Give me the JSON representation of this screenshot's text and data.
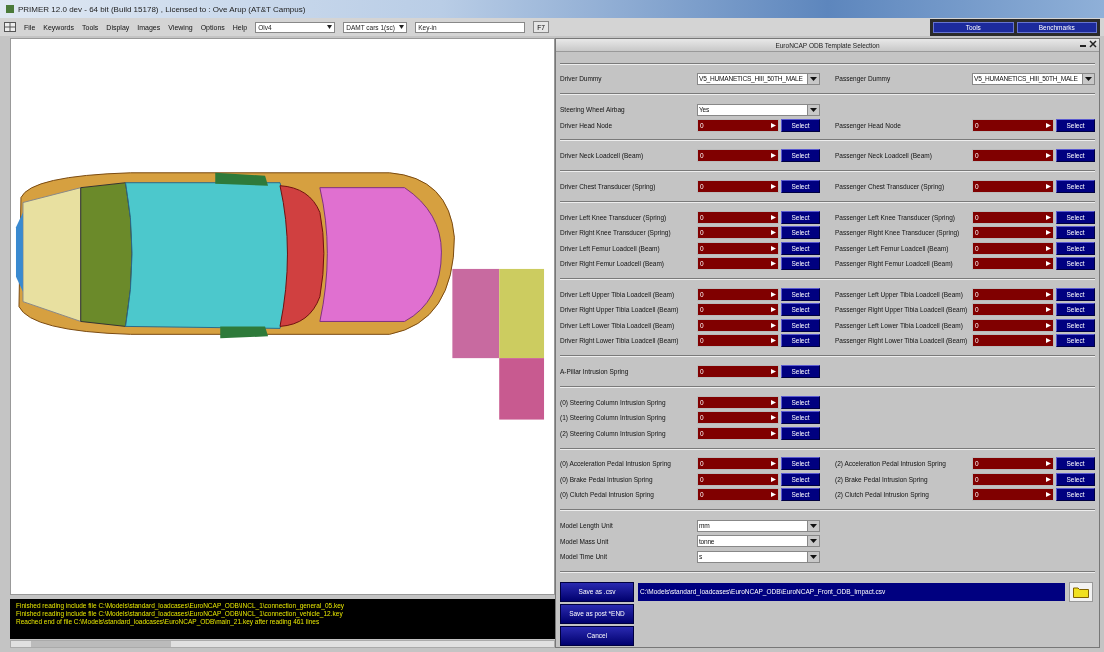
{
  "window": {
    "title": "PRIMER 12.0 dev - 64 bit (Build 15178) , Licensed to : Ove Arup (AT&T Campus)"
  },
  "menu": {
    "items": [
      "File",
      "Keywords",
      "Tools",
      "Display",
      "Images",
      "Viewing",
      "Options",
      "Help"
    ],
    "fields": [
      {
        "kind": "combo",
        "value": "Olv4"
      },
      {
        "kind": "combo",
        "value": "DAMT cars 1(sc)"
      },
      {
        "kind": "text",
        "value": "Key-in"
      }
    ],
    "button": "F7"
  },
  "side_tabs": [
    "Tools",
    "Benchmarks"
  ],
  "console": {
    "lines": [
      "Finished reading include file C:\\Models\\standard_loadcases\\EuroNCAP_ODB\\INCL_1\\connection_general_05.key",
      "Finished reading include file C:\\Models\\standard_loadcases\\EuroNCAP_ODB\\INCL_1\\connection_vehicle_12.key",
      "Reached end of file C:\\Models\\standard_loadcases\\EuroNCAP_ODB\\main_21.key after reading 461 lines"
    ]
  },
  "dialog": {
    "title": "EuroNCAP ODB Template Selection",
    "sections": [
      {
        "rows": [
          {
            "left": {
              "label": "Driver Dummy",
              "kind": "dropdown",
              "value": "V5_HUMANETICS_HIII_50TH_MALE"
            },
            "right": {
              "label": "Passenger Dummy",
              "kind": "dropdown",
              "value": "V5_HUMANETICS_HIII_50TH_MALE"
            }
          }
        ]
      },
      {
        "rows": [
          {
            "left": {
              "label": "Steering Wheel Airbag",
              "kind": "dropdown",
              "value": "Yes"
            }
          },
          {
            "left": {
              "label": "Driver Head Node",
              "kind": "entity",
              "value": "0",
              "button": "Select"
            },
            "right": {
              "label": "Passenger Head Node",
              "kind": "entity",
              "value": "0",
              "button": "Select"
            }
          }
        ]
      },
      {
        "rows": [
          {
            "left": {
              "label": "Driver Neck Loadcell (Beam)",
              "kind": "entity",
              "value": "0",
              "button": "Select"
            },
            "right": {
              "label": "Passenger Neck Loadcell (Beam)",
              "kind": "entity",
              "value": "0",
              "button": "Select"
            }
          }
        ]
      },
      {
        "rows": [
          {
            "left": {
              "label": "Driver Chest Transducer (Spring)",
              "kind": "entity",
              "value": "0",
              "button": "Select"
            },
            "right": {
              "label": "Passenger Chest Transducer (Spring)",
              "kind": "entity",
              "value": "0",
              "button": "Select"
            }
          }
        ]
      },
      {
        "rows": [
          {
            "left": {
              "label": "Driver Left Knee Transducer (Spring)",
              "kind": "entity",
              "value": "0",
              "button": "Select"
            },
            "right": {
              "label": "Passenger Left Knee Transducer (Spring)",
              "kind": "entity",
              "value": "0",
              "button": "Select"
            }
          },
          {
            "left": {
              "label": "Driver Right Knee Transducer (Spring)",
              "kind": "entity",
              "value": "0",
              "button": "Select"
            },
            "right": {
              "label": "Passenger Right Knee Transducer (Spring)",
              "kind": "entity",
              "value": "0",
              "button": "Select"
            }
          },
          {
            "left": {
              "label": "Driver Left Femur Loadcell (Beam)",
              "kind": "entity",
              "value": "0",
              "button": "Select"
            },
            "right": {
              "label": "Passenger Left Femur Loadcell (Beam)",
              "kind": "entity",
              "value": "0",
              "button": "Select"
            }
          },
          {
            "left": {
              "label": "Driver Right Femur Loadcell (Beam)",
              "kind": "entity",
              "value": "0",
              "button": "Select"
            },
            "right": {
              "label": "Passenger Right Femur Loadcell (Beam)",
              "kind": "entity",
              "value": "0",
              "button": "Select"
            }
          }
        ]
      },
      {
        "rows": [
          {
            "left": {
              "label": "Driver Left Upper Tibia Loadcell (Beam)",
              "kind": "entity",
              "value": "0",
              "button": "Select"
            },
            "right": {
              "label": "Passenger Left Upper Tibia Loadcell (Beam)",
              "kind": "entity",
              "value": "0",
              "button": "Select"
            }
          },
          {
            "left": {
              "label": "Driver Right Upper Tibia Loadcell (Beam)",
              "kind": "entity",
              "value": "0",
              "button": "Select"
            },
            "right": {
              "label": "Passenger Right Upper Tibia Loadcell (Beam)",
              "kind": "entity",
              "value": "0",
              "button": "Select"
            }
          },
          {
            "left": {
              "label": "Driver Left Lower Tibia Loadcell (Beam)",
              "kind": "entity",
              "value": "0",
              "button": "Select"
            },
            "right": {
              "label": "Passenger Left Lower Tibia Loadcell (Beam)",
              "kind": "entity",
              "value": "0",
              "button": "Select"
            }
          },
          {
            "left": {
              "label": "Driver Right Lower Tibia Loadcell (Beam)",
              "kind": "entity",
              "value": "0",
              "button": "Select"
            },
            "right": {
              "label": "Passenger Right Lower Tibia Loadcell (Beam)",
              "kind": "entity",
              "value": "0",
              "button": "Select"
            }
          }
        ]
      },
      {
        "rows": [
          {
            "left": {
              "label": "A-Pillar Intrusion Spring",
              "kind": "entity",
              "value": "0",
              "button": "Select"
            }
          }
        ]
      },
      {
        "rows": [
          {
            "left": {
              "label": "(0) Steering Column Intrusion Spring",
              "kind": "entity",
              "value": "0",
              "button": "Select"
            }
          },
          {
            "left": {
              "label": "(1) Steering Column Intrusion Spring",
              "kind": "entity",
              "value": "0",
              "button": "Select"
            }
          },
          {
            "left": {
              "label": "(2) Steering Column Intrusion Spring",
              "kind": "entity",
              "value": "0",
              "button": "Select"
            }
          }
        ]
      },
      {
        "rows": [
          {
            "left": {
              "label": "(0) Acceleration Pedal Intrusion Spring",
              "kind": "entity",
              "value": "0",
              "button": "Select"
            },
            "right": {
              "label": "(2) Acceleration Pedal Intrusion Spring",
              "kind": "entity",
              "value": "0",
              "button": "Select"
            }
          },
          {
            "left": {
              "label": "(0) Brake Pedal Intrusion Spring",
              "kind": "entity",
              "value": "0",
              "button": "Select"
            },
            "right": {
              "label": "(2) Brake Pedal Intrusion Spring",
              "kind": "entity",
              "value": "0",
              "button": "Select"
            }
          },
          {
            "left": {
              "label": "(0) Clutch Pedal Intrusion Spring",
              "kind": "entity",
              "value": "0",
              "button": "Select"
            },
            "right": {
              "label": "(2) Clutch Pedal Intrusion Spring",
              "kind": "entity",
              "value": "0",
              "button": "Select"
            }
          }
        ]
      },
      {
        "rows": [
          {
            "left": {
              "label": "Model Length Unit",
              "kind": "dropdown",
              "value": "mm"
            }
          },
          {
            "left": {
              "label": "Model Mass Unit",
              "kind": "dropdown",
              "value": "tonne"
            }
          },
          {
            "left": {
              "label": "Model Time Unit",
              "kind": "dropdown",
              "value": "s"
            }
          }
        ]
      }
    ],
    "actions": [
      "Save as .csv",
      "Save as post *END",
      "Cancel"
    ],
    "output_path": "C:\\Models\\standard_loadcases\\EuroNCAP_ODB\\EuroNCAP_Front_ODB_Impact.csv"
  }
}
